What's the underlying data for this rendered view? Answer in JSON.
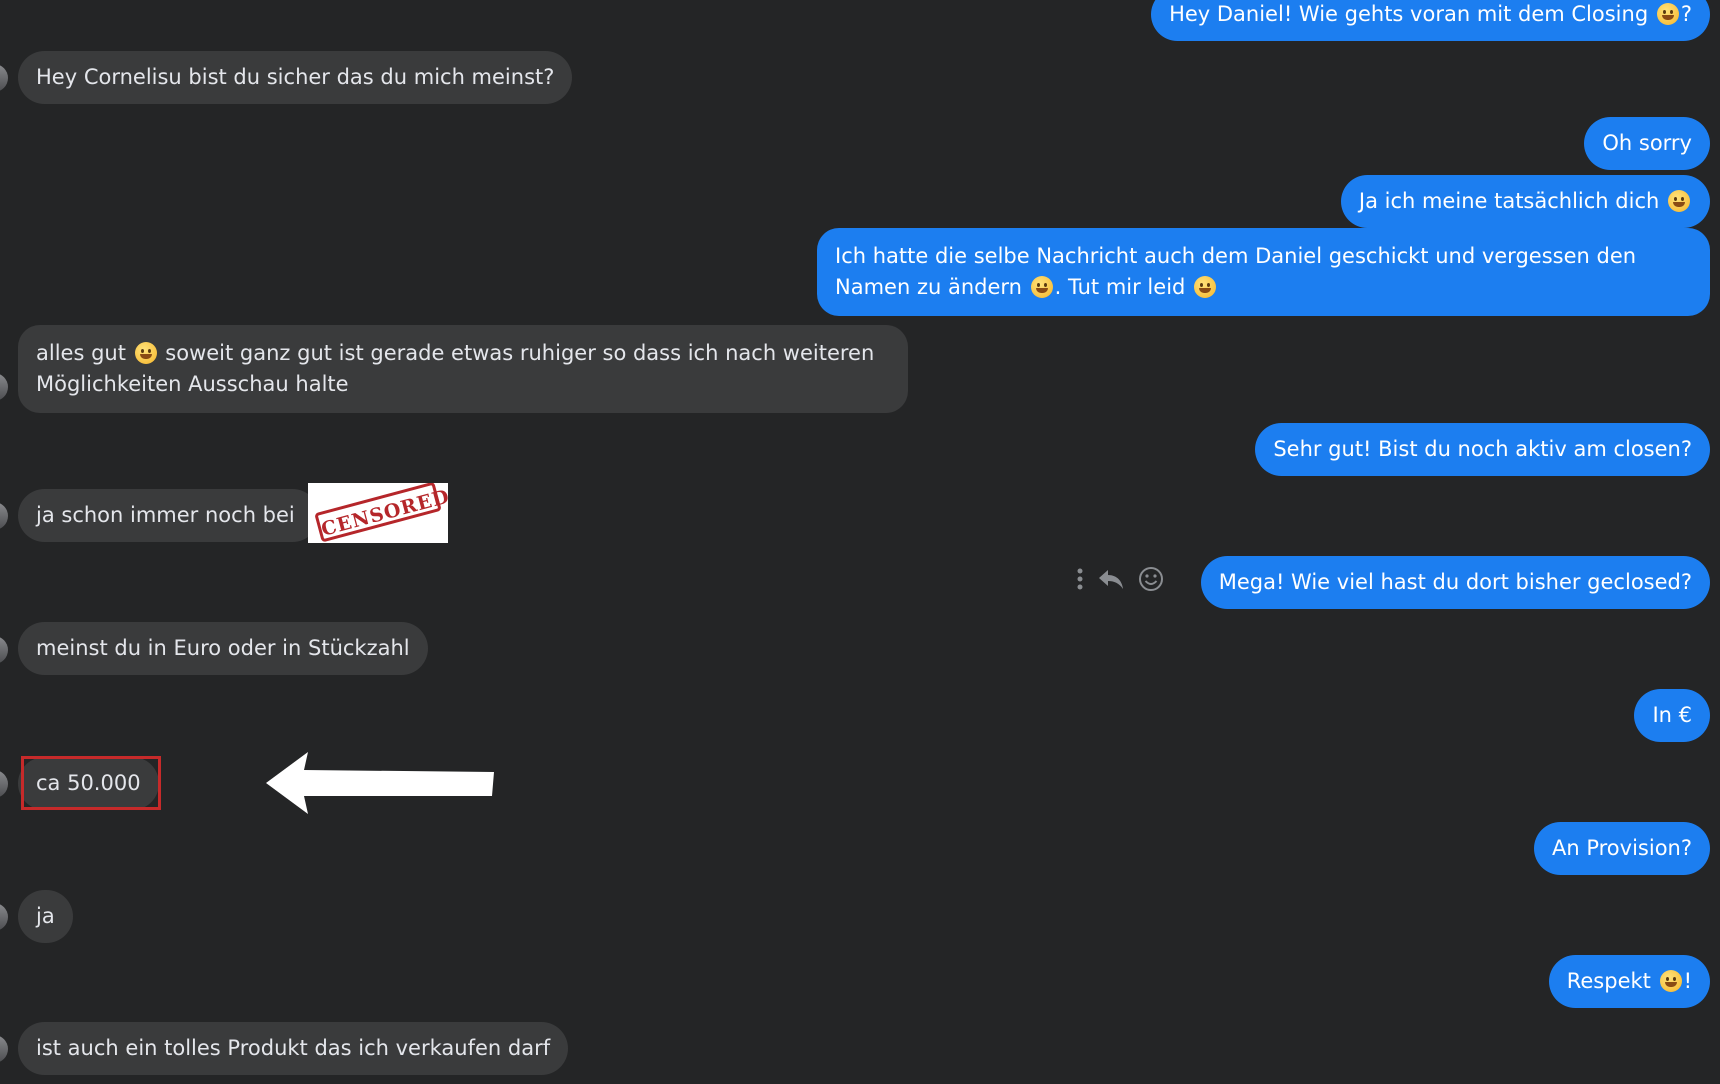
{
  "conversation": {
    "messages": [
      {
        "side": "out",
        "text_before": "Hey Daniel! Wie gehts voran mit dem Closing ",
        "emoji": "grinning-face",
        "text_after": "?"
      },
      {
        "side": "in",
        "text": "Hey Cornelisu bist du sicher das du mich meinst?"
      },
      {
        "side": "out",
        "text": "Oh sorry"
      },
      {
        "side": "out",
        "text_before": "Ja ich meine tatsächlich dich ",
        "emoji": "grinning-face"
      },
      {
        "side": "out",
        "text_part1": "Ich hatte die selbe Nachricht auch dem Daniel geschickt und vergessen den Namen zu ändern ",
        "text_part2": ". Tut mir leid "
      },
      {
        "side": "in",
        "text_part1": "alles gut ",
        "text_part2": " soweit ganz gut ist gerade etwas ruhiger so dass ich nach weiteren Möglichkeiten Ausschau halte"
      },
      {
        "side": "out",
        "text": "Sehr gut! Bist du noch aktiv am closen?"
      },
      {
        "side": "in",
        "text": "ja schon immer noch bei"
      },
      {
        "side": "out",
        "text": "Mega! Wie viel hast du dort bisher geclosed?"
      },
      {
        "side": "in",
        "text": "meinst du in Euro oder in Stückzahl"
      },
      {
        "side": "out",
        "text": "In €"
      },
      {
        "side": "in",
        "text": "ca 50.000"
      },
      {
        "side": "out",
        "text": "An Provision?"
      },
      {
        "side": "in",
        "text": "ja"
      },
      {
        "side": "out",
        "text_before": "Respekt ",
        "emoji": "grinning-face",
        "text_after": "!"
      },
      {
        "side": "in",
        "text": "ist auch ein tolles Produkt das ich verkaufen darf"
      }
    ]
  },
  "censored_stamp": {
    "text": "CENSORED",
    "color": "#b5262a"
  },
  "message_actions": {
    "icons": [
      "more-options-icon",
      "reply-icon",
      "react-icon"
    ]
  },
  "colors": {
    "background": "#242526",
    "incoming_bubble": "#3a3b3c",
    "outgoing_bubble": "#1c7ef0",
    "highlight": "#c62a2a"
  }
}
